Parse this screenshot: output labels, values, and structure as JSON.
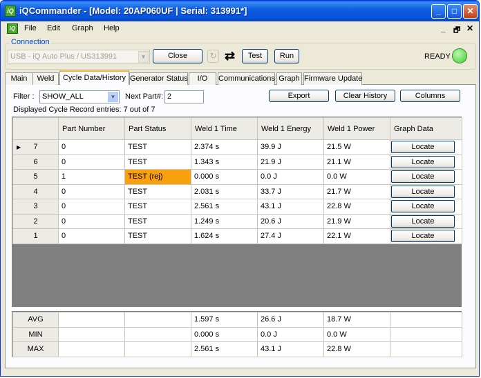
{
  "window": {
    "title": "iQCommander - [Model: 20AP060UF | Serial: 313991*]",
    "app_icon_text": "iQ"
  },
  "menu": {
    "items": [
      "File",
      "Edit",
      "Graph",
      "Help"
    ],
    "mdi_minimize": "_",
    "mdi_restore": "🗗",
    "mdi_close": "✕"
  },
  "connection": {
    "group_label": "Connection",
    "port_value": "USB - iQ Auto Plus / US313991",
    "close_label": "Close",
    "test_label": "Test",
    "run_label": "Run",
    "status_text": "READY",
    "status_color": "#6fe05e"
  },
  "tabs": [
    "Main",
    "Weld",
    "Cycle Data/History",
    "Generator Status",
    "I/O",
    "Communications",
    "Graph",
    "Firmware Update"
  ],
  "active_tab": "Cycle Data/History",
  "toolbar": {
    "filter_label": "Filter :",
    "filter_value": "SHOW_ALL",
    "next_part_label": "Next Part#:",
    "next_part_value": "2",
    "export_label": "Export",
    "clear_history_label": "Clear History",
    "columns_label": "Columns",
    "displayed_text": "Displayed Cycle Record entries: 7 out of 7"
  },
  "grid": {
    "columns": [
      "Part Number",
      "Part Status",
      "Weld 1 Time",
      "Weld 1 Energy",
      "Weld 1 Power",
      "Graph Data"
    ],
    "rows": [
      {
        "id": "7",
        "part_number": "0",
        "status": "TEST",
        "time": "2.374 s",
        "energy": "39.9 J",
        "power": "21.5 W",
        "graph": "Locate"
      },
      {
        "id": "6",
        "part_number": "0",
        "status": "TEST",
        "time": "1.343 s",
        "energy": "21.9 J",
        "power": "21.1 W",
        "graph": "Locate"
      },
      {
        "id": "5",
        "part_number": "1",
        "status": "TEST (rej)",
        "time": "0.000 s",
        "energy": "0.0 J",
        "power": "0.0 W",
        "graph": "Locate"
      },
      {
        "id": "4",
        "part_number": "0",
        "status": "TEST",
        "time": "2.031 s",
        "energy": "33.7 J",
        "power": "21.7 W",
        "graph": "Locate"
      },
      {
        "id": "3",
        "part_number": "0",
        "status": "TEST",
        "time": "2.561 s",
        "energy": "43.1 J",
        "power": "22.8 W",
        "graph": "Locate"
      },
      {
        "id": "2",
        "part_number": "0",
        "status": "TEST",
        "time": "1.249 s",
        "energy": "20.6 J",
        "power": "21.9 W",
        "graph": "Locate"
      },
      {
        "id": "1",
        "part_number": "0",
        "status": "TEST",
        "time": "1.624 s",
        "energy": "27.4 J",
        "power": "22.1 W",
        "graph": "Locate"
      }
    ],
    "reject_color": "#f9a00f"
  },
  "stats": [
    {
      "label": "AVG",
      "time": "1.597 s",
      "energy": "26.6 J",
      "power": "18.7 W"
    },
    {
      "label": "MIN",
      "time": "0.000 s",
      "energy": "0.0 J",
      "power": "0.0 W"
    },
    {
      "label": "MAX",
      "time": "2.561 s",
      "energy": "43.1 J",
      "power": "22.8 W"
    }
  ]
}
